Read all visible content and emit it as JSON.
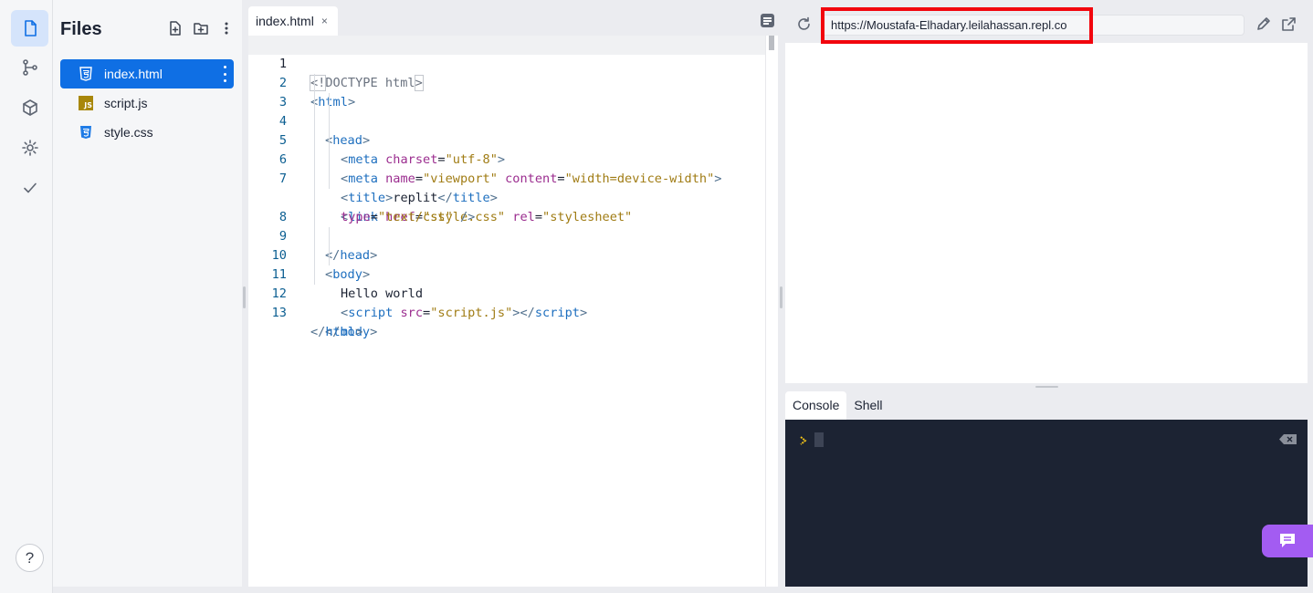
{
  "activity_bar": {
    "items": [
      {
        "name": "files",
        "icon": "file-icon",
        "active": true
      },
      {
        "name": "git",
        "icon": "git-branch-icon",
        "active": false
      },
      {
        "name": "packages",
        "icon": "package-icon",
        "active": false
      },
      {
        "name": "settings",
        "icon": "gear-icon",
        "active": false
      },
      {
        "name": "checks",
        "icon": "check-icon",
        "active": false
      }
    ],
    "help_label": "?"
  },
  "files_panel": {
    "title": "Files",
    "files": [
      {
        "name": "index.html",
        "type": "html",
        "selected": true
      },
      {
        "name": "script.js",
        "type": "js",
        "badge": "JS",
        "selected": false
      },
      {
        "name": "style.css",
        "type": "css",
        "selected": false
      }
    ]
  },
  "editor": {
    "tab": {
      "label": "index.html",
      "close": "×"
    },
    "lines": {
      "l1": {
        "n": "1",
        "a": "<!",
        "b": "DOCTYPE html",
        "c": ">"
      },
      "l2": {
        "n": "2",
        "a": "<",
        "b": "html",
        "c": ">"
      },
      "l3": {
        "n": "3",
        "a": "<",
        "b": "head",
        "c": ">"
      },
      "l4": {
        "n": "4",
        "a": "<",
        "b": "meta",
        "c": "charset",
        "d": "=",
        "e": "\"utf-8\"",
        "f": ">"
      },
      "l5": {
        "n": "5",
        "a": "<",
        "b": "meta",
        "c": "name",
        "d": "=",
        "e": "\"viewport\"",
        "g": "content",
        "h": "=",
        "i": "\"width=device-width\"",
        "f": ">"
      },
      "l6": {
        "n": "6",
        "a": "<",
        "b": "title",
        "c": ">",
        "d": "replit",
        "e": "</",
        "f": "title",
        "g": ">"
      },
      "l7": {
        "n": "7",
        "a": "<",
        "b": "link",
        "c": "href",
        "d": "=",
        "e": "\"style.css\"",
        "g": "rel",
        "h": "=",
        "i": "\"stylesheet\""
      },
      "l7b": {
        "c": "type",
        "d": "=",
        "e": "\"text/css\"",
        "f": " />"
      },
      "l8": {
        "n": "8",
        "a": "</",
        "b": "head",
        "c": ">"
      },
      "l9": {
        "n": "9",
        "a": "<",
        "b": "body",
        "c": ">"
      },
      "l10": {
        "n": "10",
        "text": "Hello world"
      },
      "l11": {
        "n": "11",
        "a": "<",
        "b": "script",
        "c": "src",
        "d": "=",
        "e": "\"script.js\"",
        "f": "></",
        "g": "script",
        "h": ">"
      },
      "l12": {
        "n": "12",
        "a": "</",
        "b": "body",
        "c": ">"
      },
      "l13": {
        "n": "13",
        "a": "</",
        "b": "html",
        "c": ">"
      }
    }
  },
  "webview": {
    "url": "https://Moustafa-Elhadary.leilahassan.repl.co",
    "highlight_color": "#f2050d"
  },
  "console": {
    "tabs": [
      "Console",
      "Shell"
    ],
    "prompt": "›",
    "background": "#1c2333"
  },
  "colors": {
    "accent": "#0f6fe4",
    "chat_button": "#a35cf2"
  }
}
